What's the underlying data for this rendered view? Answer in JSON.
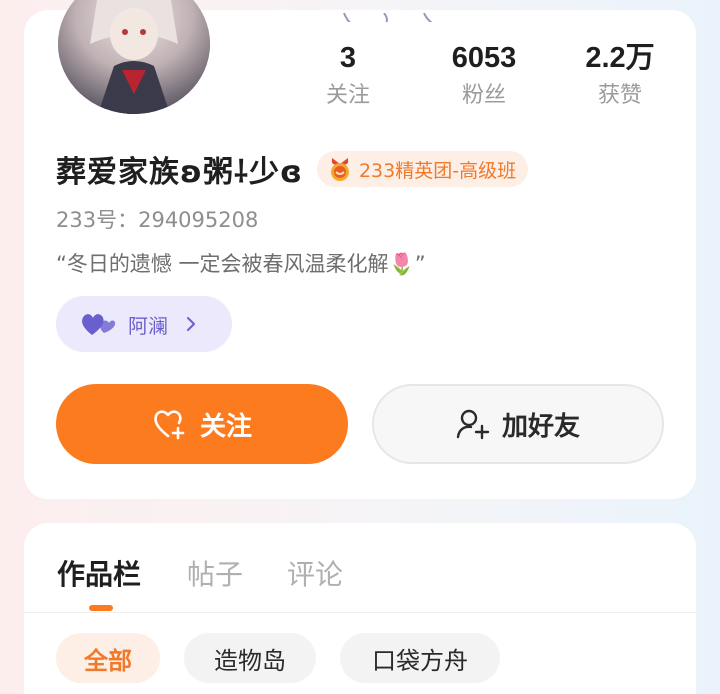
{
  "stats": [
    {
      "value": "3",
      "label": "关注"
    },
    {
      "value": "6053",
      "label": "粉丝"
    },
    {
      "value": "2.2万",
      "label": "获赞"
    }
  ],
  "profile": {
    "username": "葬爱家族ʚ粥⸸少ɞ",
    "class_badge": "233精英团-高级班",
    "uid_label": "233号：",
    "uid_value": "294095208",
    "signature": "“冬日的遗憾 一定会被春风温柔化解🌷”",
    "family_chip": "阿澜"
  },
  "actions": {
    "follow_label": "关注",
    "add_friend_label": "加好友"
  },
  "tabs": [
    {
      "label": "作品栏",
      "active": true
    },
    {
      "label": "帖子",
      "active": false
    },
    {
      "label": "评论",
      "active": false
    }
  ],
  "filters": [
    {
      "label": "全部",
      "active": true
    },
    {
      "label": "造物岛",
      "active": false
    },
    {
      "label": "口袋方舟",
      "active": false
    }
  ],
  "colors": {
    "accent": "#fd7b1f",
    "badge_text": "#f07a2c",
    "family_purple": "#6a5fcf"
  },
  "icons": {
    "follow": "heart-plus-icon",
    "add_friend": "user-plus-icon",
    "family": "double-heart-icon",
    "badge": "medal-icon"
  }
}
